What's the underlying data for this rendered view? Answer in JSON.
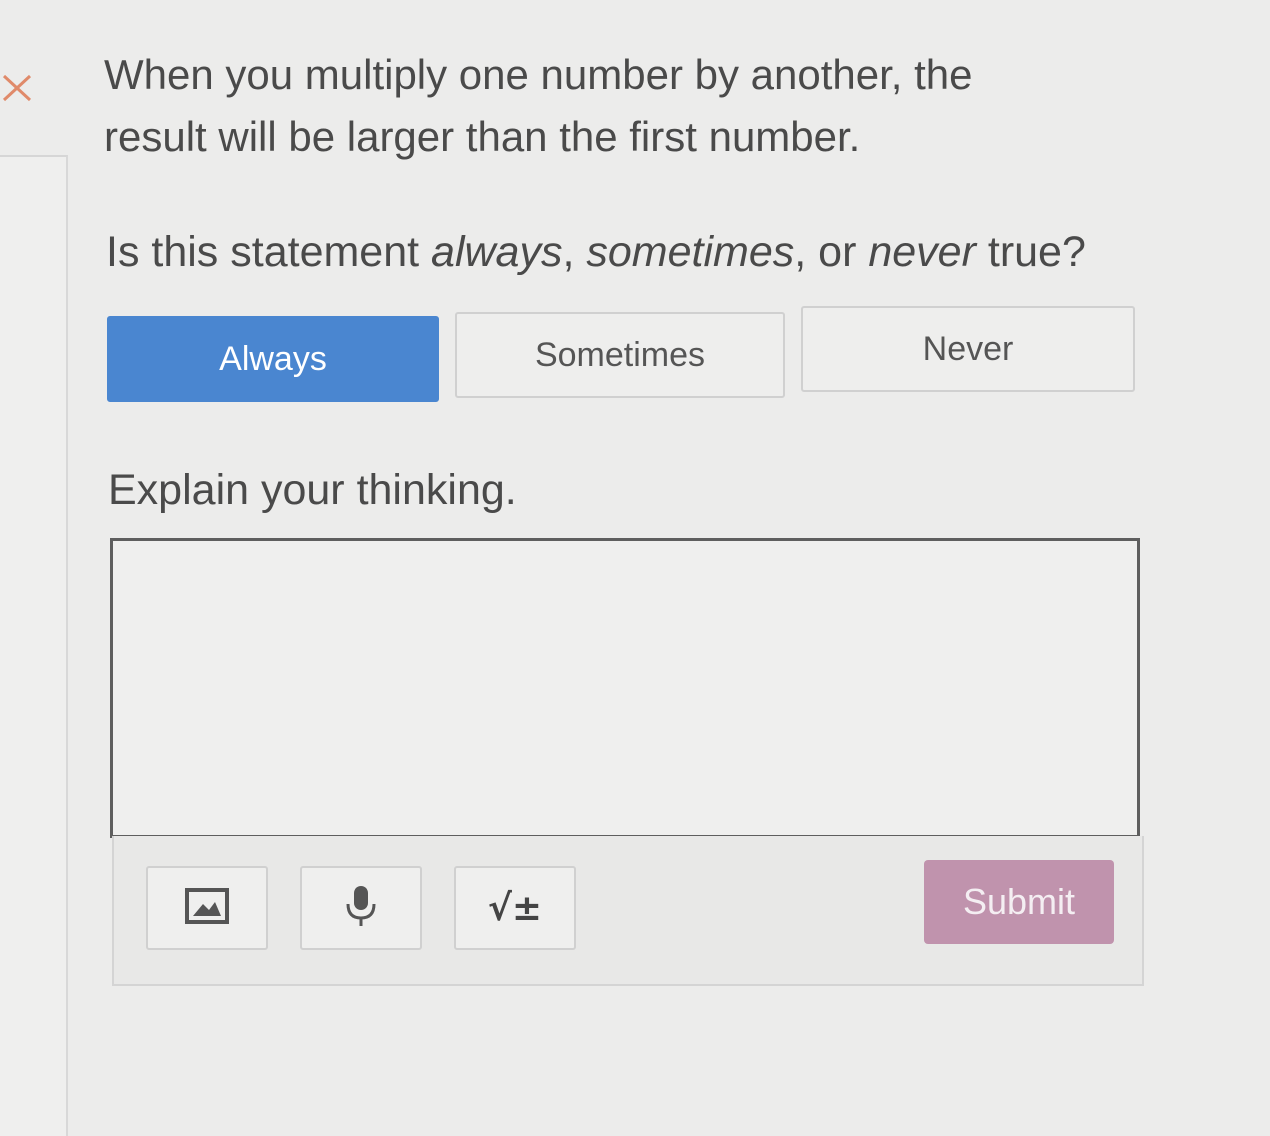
{
  "question": {
    "statement": "When you multiply one number by another, the result will be larger than the first number.",
    "prompt_parts": [
      "Is this statement ",
      "always",
      ", ",
      "sometimes",
      ", or ",
      "never",
      " true?"
    ]
  },
  "choices": [
    {
      "label": "Always",
      "selected": true
    },
    {
      "label": "Sometimes",
      "selected": false
    },
    {
      "label": "Never",
      "selected": false
    }
  ],
  "explain": {
    "label": "Explain your thinking.",
    "value": "",
    "placeholder": ""
  },
  "toolbar": {
    "image_icon": "image-icon",
    "mic_icon": "microphone-icon",
    "math_icon": "math-equation-icon",
    "math_glyph": "√±",
    "submit_label": "Submit"
  },
  "colors": {
    "selected": "#4a86d0",
    "submit": "#c093ad",
    "close": "#e08a6a"
  }
}
